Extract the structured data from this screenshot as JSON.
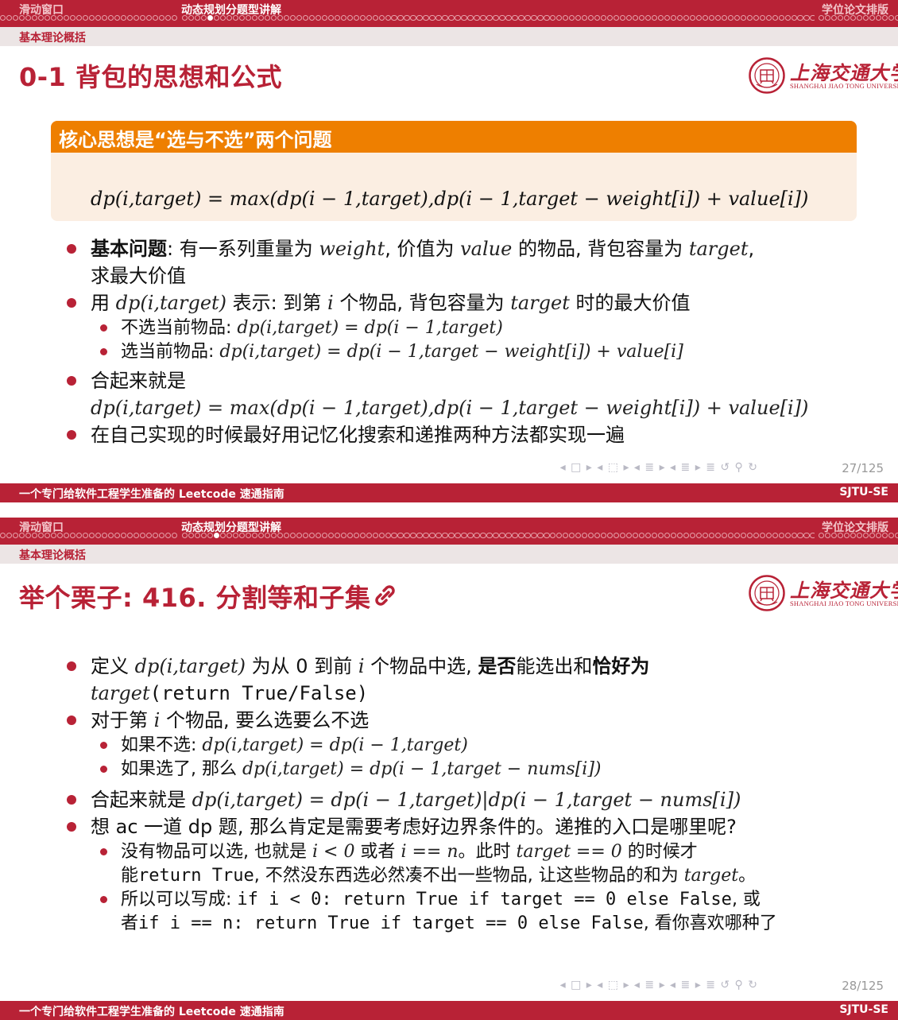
{
  "slides": [
    {
      "nav": {
        "left": "滑动窗口",
        "middle": "动态规划分题型讲解",
        "right": "学位论文排版",
        "current_index": 4
      },
      "section": "基本理论概括",
      "title": "0-1 背包的思想和公式",
      "logo": {
        "cn": "上海交通大学",
        "en": "SHANGHAI JIAO TONG UNIVERSITY"
      },
      "block": {
        "title": "核心思想是“选与不选”两个问题",
        "formula": "dp(i,target) = max(dp(i − 1,target),dp(i − 1,target − weight[i]) + value[i])"
      },
      "bullets": {
        "b1_label": "基本问题",
        "b1_text_a": ": 有一系列重量为 ",
        "b1_weight": "weight",
        "b1_text_b": ", 价值为 ",
        "b1_value": "value",
        "b1_text_c": " 的物品, 背包容量为 ",
        "b1_target": "target",
        "b1_text_d": ",",
        "b1_cont": "求最大价值",
        "b2_a": "用 ",
        "b2_math": "dp(i,target)",
        "b2_b": " 表示: 到第 ",
        "b2_i": "i",
        "b2_c": " 个物品, 背包容量为 ",
        "b2_target": "target",
        "b2_d": " 时的最大价值",
        "s1_label": "不选当前物品: ",
        "s1_math": "dp(i,target) = dp(i − 1,target)",
        "s2_label": "选当前物品: ",
        "s2_math": "dp(i,target) = dp(i − 1,target − weight[i]) + value[i]",
        "b3": "合起来就是",
        "b3_math": "dp(i,target) = max(dp(i − 1,target),dp(i − 1,target − weight[i]) + value[i])",
        "b4": "在自己实现的时候最好用记忆化搜索和递推两种方法都实现一遍"
      },
      "nav_symbols": "◂ □ ▸ ◂ ⬚ ▸ ◂ ≣ ▸ ◂ ≣ ▸    ≣    ↺ ⚲ ↻",
      "page": "27/125",
      "footer": {
        "left": "一个专门给软件工程学生准备的 Leetcode 速通指南",
        "right": "SJTU-SE"
      }
    },
    {
      "nav": {
        "left": "滑动窗口",
        "middle": "动态规划分题型讲解",
        "right": "学位论文排版",
        "current_index": 5
      },
      "section": "基本理论概括",
      "title": "举个栗子: 416. 分割等和子集",
      "logo": {
        "cn": "上海交通大学",
        "en": "SHANGHAI JIAO TONG UNIVERSITY"
      },
      "bullets": {
        "b1_a": "定义 ",
        "b1_math": "dp(i,target)",
        "b1_b": " 为从 0 到前 ",
        "b1_i": "i",
        "b1_c": " 个物品中选, ",
        "b1_bold1": "是否",
        "b1_d": "能选出和",
        "b1_bold2": "恰好为",
        "b1_cont_math": "target",
        "b1_cont_mono": "(return True/False)",
        "b2_a": "对于第 ",
        "b2_i": "i",
        "b2_b": " 个物品, 要么选要么不选",
        "s1_label": "如果不选: ",
        "s1_math": "dp(i,target) = dp(i − 1,target)",
        "s2_label": "如果选了, 那么 ",
        "s2_math": "dp(i,target) = dp(i − 1,target − nums[i])",
        "b3_a": "合起来就是 ",
        "b3_math": "dp(i,target) = dp(i − 1,target)|dp(i − 1,target − nums[i])",
        "b4": "想 ac 一道 dp 题, 那么肯定是需要考虑好边界条件的。递推的入口是哪里呢?",
        "s3_a": "没有物品可以选, 也就是 ",
        "s3_m1": "i < 0",
        "s3_b": " 或者 ",
        "s3_m2": "i == n",
        "s3_c": "。此时 ",
        "s3_m3": "target == 0",
        "s3_d": " 的时候才",
        "s3_cont_a": "能",
        "s3_cont_mono": "return True",
        "s3_cont_b": ", 不然没东西选必然凑不出一些物品, 让这些物品的和为 ",
        "s3_cont_math": "target",
        "s3_cont_c": "。",
        "s4_a": "所以可以写成: ",
        "s4_mono": "if i < 0: return True if target == 0 else False",
        "s4_b": ", 或",
        "s4_cont_a": "者",
        "s4_cont_mono": "if i == n: return True if target == 0 else False",
        "s4_cont_b": ", 看你喜欢哪种了"
      },
      "nav_symbols": "◂ □ ▸ ◂ ⬚ ▸ ◂ ≣ ▸ ◂ ≣ ▸    ≣    ↺ ⚲ ↻",
      "page": "28/125",
      "footer": {
        "left": "一个专门给软件工程学生准备的 Leetcode 速通指南",
        "right": "SJTU-SE"
      }
    }
  ],
  "colors": {
    "accent": "#b82236",
    "block_head": "#ee7f00",
    "block_body": "#fbeee2"
  },
  "icons": [
    "link-icon",
    "sjtu-seal-icon"
  ]
}
